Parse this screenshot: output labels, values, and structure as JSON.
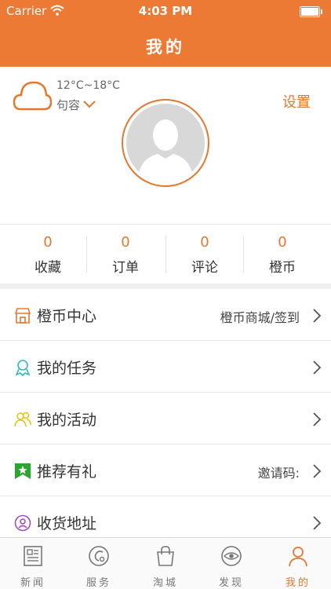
{
  "status_bar": {
    "carrier": "Carrier",
    "time": "4:03 PM"
  },
  "nav": {
    "title": "我的"
  },
  "profile": {
    "weather_temp": "12°C~18°C",
    "weather_city": "句容",
    "settings_label": "设置"
  },
  "stats": [
    {
      "value": "0",
      "label": "收藏"
    },
    {
      "value": "0",
      "label": "订单"
    },
    {
      "value": "0",
      "label": "评论"
    },
    {
      "value": "0",
      "label": "橙币"
    }
  ],
  "menu": [
    {
      "label": "橙币中心",
      "extra": "橙币商城/签到",
      "icon": "store-icon"
    },
    {
      "label": "我的任务",
      "extra": "",
      "icon": "ribbon-icon"
    },
    {
      "label": "我的活动",
      "extra": "",
      "icon": "people-icon"
    },
    {
      "label": "推荐有礼",
      "extra": "邀请码:",
      "icon": "star-flag-icon"
    },
    {
      "label": "收货地址",
      "extra": "",
      "icon": "location-icon"
    }
  ],
  "tabs": [
    {
      "label": "新闻",
      "icon": "newspaper-icon"
    },
    {
      "label": "服务",
      "icon": "service-icon"
    },
    {
      "label": "淘城",
      "icon": "shopping-bag-icon"
    },
    {
      "label": "发现",
      "icon": "eye-icon"
    },
    {
      "label": "我的",
      "icon": "person-icon",
      "active": true
    }
  ],
  "colors": {
    "brand": "#ec7a35",
    "accent_text": "#e5782f",
    "background_gap": "#efefef"
  }
}
